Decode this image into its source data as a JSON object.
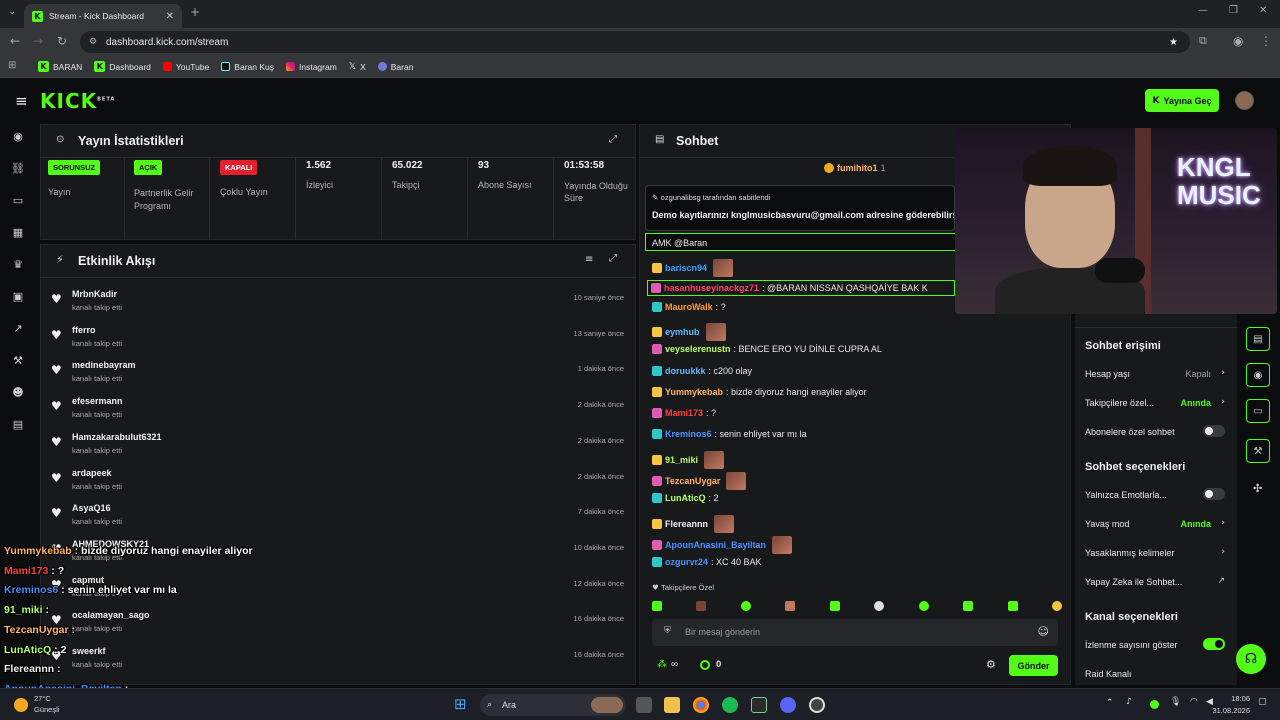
{
  "browser": {
    "tab_title": "Stream - Kick Dashboard",
    "url": "dashboard.kick.com/stream",
    "bookmarks": [
      "BARAN",
      "Dashboard",
      "YouTube",
      "Baran Kuş",
      "Instagram",
      "X",
      "Baran"
    ]
  },
  "header": {
    "logo": "KICK",
    "logo_sup": "BETA",
    "go_live": "Yayına Geç"
  },
  "stats": {
    "title": "Yayın İstatistikleri",
    "items": [
      {
        "pill": "SORUNSUZ",
        "label": "Yayın",
        "pill_color": "#53fc18"
      },
      {
        "pill": "AÇIK",
        "label": "Partnerlik Gelir Programı",
        "pill_color": "#53fc18"
      },
      {
        "pill": "KAPALI",
        "label": "Çoklu Yayın",
        "pill_color": "#e0202c"
      },
      {
        "value": "1.562",
        "label": "İzleyici"
      },
      {
        "value": "65.022",
        "label": "Takipçi"
      },
      {
        "value": "93",
        "label": "Abone Sayısı"
      },
      {
        "value": "01:53:58",
        "label": "Yayında Olduğu Süre"
      }
    ]
  },
  "activity": {
    "title": "Etkinlik Akışı",
    "action": "kanalı takip etti",
    "events": [
      {
        "user": "MrbnKadir",
        "time": "10 saniye önce"
      },
      {
        "user": "fferro",
        "time": "13 saniye önce"
      },
      {
        "user": "medinebayram",
        "time": "1 dakika önce"
      },
      {
        "user": "efesermann",
        "time": "2 dakika önce"
      },
      {
        "user": "Hamzakarabulut6321",
        "time": "2 dakika önce"
      },
      {
        "user": "ardapeek",
        "time": "2 dakika önce"
      },
      {
        "user": "AsyaQ16",
        "time": "7 dakika önce"
      },
      {
        "user": "AHMEDOWSKY21",
        "time": "10 dakika önce"
      },
      {
        "user": "capmut",
        "time": "12 dakika önce"
      },
      {
        "user": "ocalamayan_sago",
        "time": "16 dakika önce"
      },
      {
        "user": "sweerkf",
        "time": "16 dakika önce"
      }
    ]
  },
  "chat": {
    "title": "Sohbet",
    "top_gifter": "fumihito1",
    "top_gifter_count": "1",
    "pinned_by": "ozgunalibsg tarafından sabitlendi",
    "pinned_text": "Demo kayıtlarınızı kngImusicbasvuru@gmail.com adresine göderebilirsiniz",
    "reply_line": "AMK @Baran",
    "messages": [
      {
        "user": "bariscn94",
        "text": "",
        "color": "#3aa0ff"
      },
      {
        "user": "hasanhuseyinackgz71",
        "text": ": @BARAN NISSAN QASHQAİYE BAK K",
        "color": "#ff3d6b"
      },
      {
        "user": "MauroWalk",
        "text": ": ?",
        "color": "#ff9a3a"
      },
      {
        "user": "eymhub",
        "text": "",
        "color": "#64b8ff"
      },
      {
        "user": "veyselerenustn",
        "text": ": BENCE ERO YU DİNLE CUPRA AL",
        "color": "#b6ff6a"
      },
      {
        "user": "doruukkk",
        "text": ": c200 olay",
        "color": "#64b8ff"
      },
      {
        "user": "Yummykebab",
        "text": ": bizde diyoruz hangi enayiler aliyor",
        "color": "#ffb36b"
      },
      {
        "user": "Mami173",
        "text": ": ?",
        "color": "#ff4040"
      },
      {
        "user": "Kreminos6",
        "text": ": senin ehliyet var mı la",
        "color": "#4a90ff"
      },
      {
        "user": "91_miki",
        "text": "",
        "color": "#b6ff6a"
      },
      {
        "user": "TezcanUygar",
        "text": "",
        "color": "#ffb36b"
      },
      {
        "user": "LunAticQ",
        "text": ": 2",
        "color": "#b6ff6a"
      },
      {
        "user": "Flereannn",
        "text": "",
        "color": "#f0f0f0"
      },
      {
        "user": "ApounAnasini_Bayiltan",
        "text": "",
        "color": "#4a90ff"
      },
      {
        "user": "ozgurvr24",
        "text": ": XC 40 BAK",
        "color": "#4a90ff"
      }
    ],
    "followers_only": "Takipçilere Özel",
    "input_placeholder": "Bir mesaj gönderin",
    "points": "∞",
    "count": "0",
    "send": "Gönder"
  },
  "settings": {
    "access_title": "Sohbet erişimi",
    "account_age": "Hesap yaşı",
    "account_age_val": "Kapalı",
    "followers_only": "Takipçilere özel...",
    "followers_only_val": "Anında",
    "subs_only": "Abonelere özel sohbet",
    "options_title": "Sohbet seçenekleri",
    "emotes_only": "Yalnızca Emotlarla...",
    "slow_mode": "Yavaş mod",
    "slow_mode_val": "Anında",
    "banned_words": "Yasaklanmış kelimeler",
    "ai": "Yapay Zeka ile Sohbet...",
    "channel_title": "Kanal seçenekleri",
    "show_viewers": "İzlenme sayısını göster",
    "raid": "Raid Kanalı"
  },
  "webcam": {
    "sign_line1": "KNGL",
    "sign_line2": "MUSIC"
  },
  "overlay": [
    {
      "user": "Yummykebab",
      "text": " : bizde diyoruz hangi enayiler aliyor",
      "color": "#ffb36b"
    },
    {
      "user": "Mami173",
      "text": " : ?",
      "color": "#ff4040"
    },
    {
      "user": "Kreminos6",
      "text": " : senin ehliyet var mı la",
      "color": "#4a90ff"
    },
    {
      "user": "91_miki",
      "text": " :",
      "color": "#b6ff6a"
    },
    {
      "user": "TezcanUygar",
      "text": " :",
      "color": "#ffb36b"
    },
    {
      "user": "LunAticQ",
      "text": " : 2",
      "color": "#b6ff6a"
    },
    {
      "user": "Flereannn",
      "text": " :",
      "color": "#f0f0f0"
    },
    {
      "user": "ApounAnasini_Bayiltan",
      "text": " :",
      "color": "#4a90ff"
    }
  ],
  "taskbar": {
    "weather_temp": "27°C",
    "weather_label": "Güneşli",
    "search": "Ara",
    "time": "18:06",
    "date": "31.08.2026"
  }
}
